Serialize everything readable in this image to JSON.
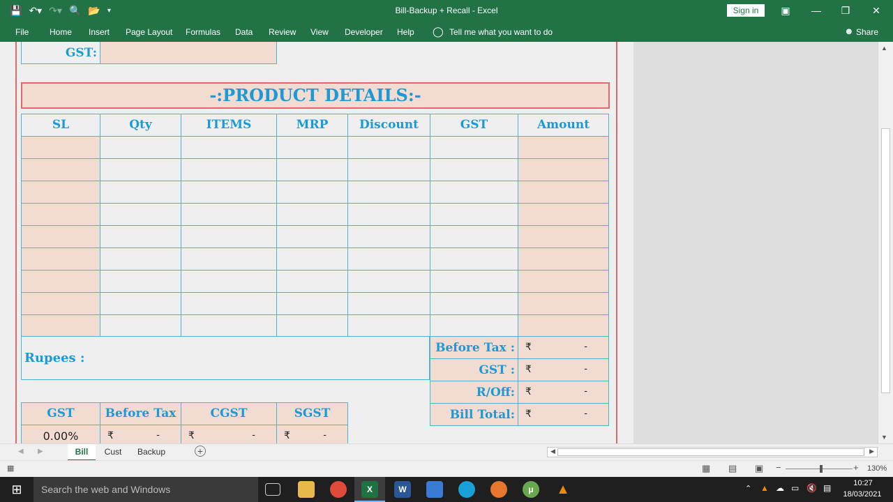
{
  "window": {
    "title": "Bill-Backup + Recall  -  Excel",
    "sign_in": "Sign in"
  },
  "menu": {
    "file": "File",
    "home": "Home",
    "insert": "Insert",
    "page_layout": "Page Layout",
    "formulas": "Formulas",
    "data": "Data",
    "review": "Review",
    "view": "View",
    "developer": "Developer",
    "help": "Help",
    "tell_me": "Tell me what you want to do",
    "share": "Share"
  },
  "sheet": {
    "gst_label": "GST:",
    "product_title": "-:PRODUCT DETAILS:-",
    "columns": [
      "SL",
      "Qty",
      "ITEMS",
      "MRP",
      "Discount",
      "GST",
      "Amount"
    ],
    "rupees_label": "Rupees :",
    "totals": [
      {
        "label": "Before Tax :",
        "currency": "₹",
        "value": "-"
      },
      {
        "label": "GST :",
        "currency": "₹",
        "value": "-"
      },
      {
        "label": "R/Off:",
        "currency": "₹",
        "value": "-"
      },
      {
        "label": "Bill Total:",
        "currency": "₹",
        "value": "-"
      }
    ],
    "gst_table": {
      "headers": [
        "GST",
        "Before Tax",
        "CGST",
        "SGST"
      ],
      "row": {
        "gst": "0.00%",
        "currency": "₹",
        "before_tax": "-",
        "cgst": "-",
        "sgst": "-"
      }
    }
  },
  "tabs": [
    "Bill",
    "Cust",
    "Backup"
  ],
  "status": {
    "zoom": "130%"
  },
  "taskbar": {
    "search_placeholder": "Search the web and Windows",
    "time": "10:27",
    "date": "18/03/2021"
  },
  "colors": {
    "excel_green": "#217346",
    "header_text": "#1a9ad6",
    "pink_fill": "#f2dcd2",
    "border_blue": "#4fb3d4",
    "border_red": "#e06868"
  }
}
